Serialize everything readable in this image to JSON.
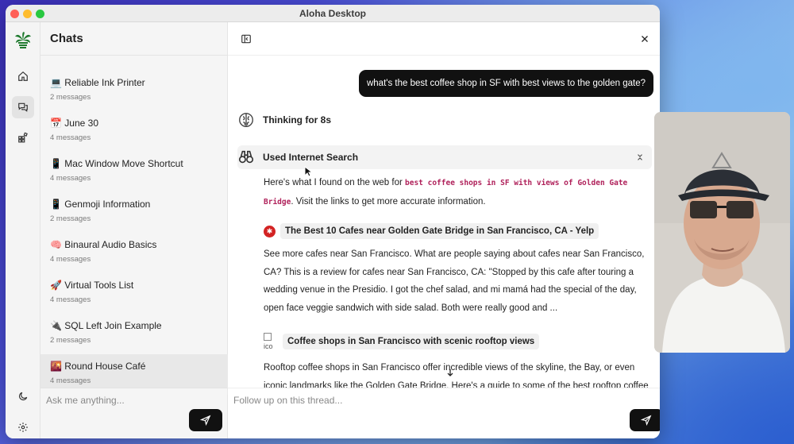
{
  "window": {
    "title": "Aloha Desktop"
  },
  "rail": {
    "items": [
      {
        "name": "home-icon"
      },
      {
        "name": "chats-icon",
        "active": true
      },
      {
        "name": "apps-icon"
      }
    ],
    "bottom": [
      {
        "name": "theme-toggle-icon"
      },
      {
        "name": "settings-icon"
      }
    ]
  },
  "sidebar": {
    "title": "Chats",
    "chats": [
      {
        "emoji": "💻",
        "title": "Reliable Ink Printer",
        "count": "2 messages"
      },
      {
        "emoji": "📅",
        "title": "June 30",
        "count": "4 messages"
      },
      {
        "emoji": "📱",
        "title": "Mac Window Move Shortcut",
        "count": "4 messages"
      },
      {
        "emoji": "📱",
        "title": "Genmoji Information",
        "count": "2 messages"
      },
      {
        "emoji": "🧠",
        "title": "Binaural Audio Basics",
        "count": "4 messages"
      },
      {
        "emoji": "🚀",
        "title": "Virtual Tools List",
        "count": "4 messages"
      },
      {
        "emoji": "🔌",
        "title": "SQL Left Join Example",
        "count": "2 messages"
      },
      {
        "emoji": "🌇",
        "title": "Round House Café",
        "count": "4 messages",
        "active": true
      }
    ],
    "input_placeholder": "Ask me anything..."
  },
  "main": {
    "user_message": "what's the best coffee shop in SF with best views to the golden gate?",
    "thinking_label": "Thinking for 8s",
    "tool_label": "Used Internet Search",
    "intro": {
      "before": "Here's what I found on the web for ",
      "query": "best coffee shops in SF with views of Golden Gate Bridge",
      "after": ". Visit the links to get more accurate information."
    },
    "results": [
      {
        "icon": "yelp-icon",
        "title": "The Best 10 Cafes near Golden Gate Bridge in San Francisco, CA - Yelp",
        "snippet": "See more cafes near San Francisco. What are people saying about cafes near San Francisco, CA? This is a review for cafes near San Francisco, CA: \"Stopped by this cafe after touring a wedding venue in the Presidio. I got the chef salad, and mi mamá had the special of the day, open face veggie sandwich with side salad. Both were really good and ..."
      },
      {
        "icon": "broken-image-icon",
        "icon_alt": "ico",
        "title": "Coffee shops in San Francisco with scenic rooftop views",
        "snippet": "Rooftop coffee shops in San Francisco offer incredible views of the skyline, the Bay, or even iconic landmarks like the Golden Gate Bridge. Here's a guide to some of the best rooftop coffee"
      }
    ],
    "followup_placeholder": "Follow up on this thread..."
  }
}
